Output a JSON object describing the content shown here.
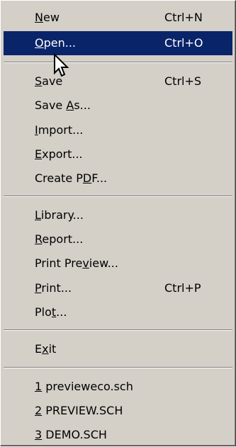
{
  "menu": {
    "items": [
      {
        "pre": "",
        "accel": "N",
        "post": "ew",
        "shortcut": "Ctrl+N"
      },
      {
        "pre": "",
        "accel": "O",
        "post": "pen...",
        "shortcut": "Ctrl+O"
      },
      {
        "pre": "",
        "accel": "S",
        "post": "ave",
        "shortcut": "Ctrl+S"
      },
      {
        "pre": "Save ",
        "accel": "A",
        "post": "s...",
        "shortcut": ""
      },
      {
        "pre": "",
        "accel": "I",
        "post": "mport...",
        "shortcut": ""
      },
      {
        "pre": "",
        "accel": "E",
        "post": "xport...",
        "shortcut": ""
      },
      {
        "pre": "Create P",
        "accel": "D",
        "post": "F...",
        "shortcut": ""
      },
      {
        "pre": "",
        "accel": "L",
        "post": "ibrary...",
        "shortcut": ""
      },
      {
        "pre": "",
        "accel": "R",
        "post": "eport...",
        "shortcut": ""
      },
      {
        "pre": "Print Pre",
        "accel": "v",
        "post": "iew...",
        "shortcut": ""
      },
      {
        "pre": "",
        "accel": "P",
        "post": "rint...",
        "shortcut": "Ctrl+P"
      },
      {
        "pre": "Plo",
        "accel": "t",
        "post": "...",
        "shortcut": ""
      },
      {
        "pre": "E",
        "accel": "x",
        "post": "it",
        "shortcut": ""
      },
      {
        "pre": "",
        "accel": "1",
        "post": " previeweco.sch",
        "shortcut": ""
      },
      {
        "pre": "",
        "accel": "2",
        "post": " PREVIEW.SCH",
        "shortcut": ""
      },
      {
        "pre": "",
        "accel": "3",
        "post": " DEMO.SCH",
        "shortcut": ""
      }
    ]
  },
  "colors": {
    "menu_background": "#d4d0c8",
    "selection_background": "#0a246a",
    "selection_text": "#ffffff"
  },
  "selected_item": "Open...",
  "cursor_icon": "arrow-pointer-icon"
}
